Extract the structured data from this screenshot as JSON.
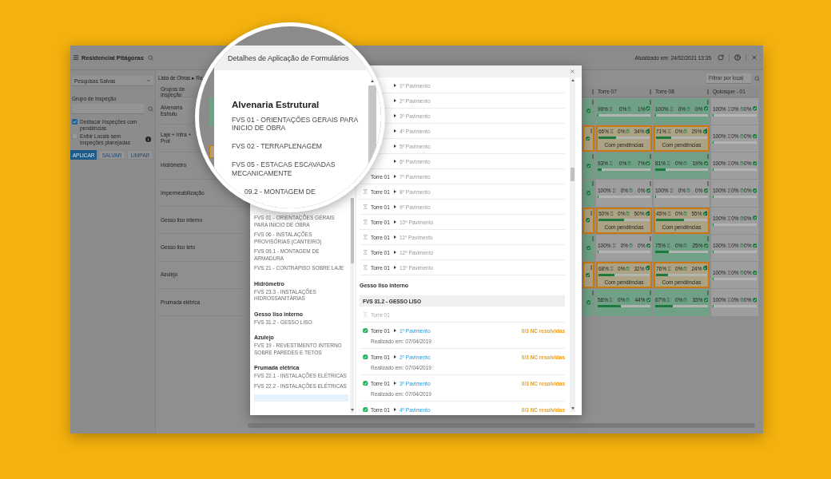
{
  "app": {
    "title": "Residencial Pitágoras",
    "updated": "Atualizado em: 24/02/2021 13:35",
    "sidebar": {
      "saved_searches": "Pesquisas Salvas",
      "group_label": "Grupo de Inspeção",
      "options": [
        {
          "label": "Destacar Inspeções com pendências",
          "checked": true,
          "info": false
        },
        {
          "label": "Exibir Locais sem Inspeções planejadas",
          "checked": false,
          "info": true
        }
      ],
      "buttons": [
        {
          "label": "APLICAR",
          "primary": true
        },
        {
          "label": "SALVAR",
          "primary": false
        },
        {
          "label": "LIMPAR",
          "primary": false
        }
      ]
    },
    "breadcrumb": "Lista de Obras ▸ Re",
    "filter": {
      "placeholder": "Filtrar por local"
    },
    "grid": {
      "row_header": "Grupos de Inspeção",
      "columns": [
        {
          "menu": true
        },
        {
          "label": "Torre 07",
          "menu": true
        },
        {
          "label": "Torre 08",
          "menu": true
        },
        {
          "label": "Quiosque - 01",
          "menu": false
        }
      ],
      "rows": [
        {
          "label": "Alvenaria Estrutu",
          "cells": [
            {
              "color": "#70a086",
              "highlighted": false,
              "menu": true
            },
            {
              "color": "#70a086",
              "highlighted": false,
              "waiting": "99%",
              "open": "0%",
              "done": "1%",
              "level": 0.01,
              "menu": true
            },
            {
              "color": "#70a086",
              "highlighted": false,
              "waiting": "100%",
              "open": "0%",
              "done": "0%",
              "level": 0,
              "menu": true
            },
            {
              "color": "#9e9e9e",
              "highlighted": false,
              "waiting": "100%",
              "open": "0%",
              "done": "0%",
              "level": 0,
              "menu": false
            }
          ]
        },
        {
          "label": "Laje + Infra + Prot",
          "cells": [
            {
              "color": "#aca385",
              "highlighted": true,
              "menu": true
            },
            {
              "color": "#aca385",
              "highlighted": true,
              "waiting": "66%",
              "open": "0%",
              "done": "34%",
              "level": 0.34,
              "note": "Com pendências",
              "menu": true
            },
            {
              "color": "#aca385",
              "highlighted": true,
              "waiting": "71%",
              "open": "0%",
              "done": "29%",
              "level": 0.29,
              "note": "Com pendências",
              "menu": true
            },
            {
              "color": "#9e9e9e",
              "highlighted": false,
              "waiting": "100%",
              "open": "0%",
              "done": "0%",
              "level": 0,
              "menu": false
            }
          ]
        },
        {
          "label": "Hidrômetro",
          "cells": [
            {
              "color": "#70a086",
              "highlighted": false,
              "menu": true
            },
            {
              "color": "#70a086",
              "highlighted": false,
              "waiting": "93%",
              "open": "0%",
              "done": "7%",
              "level": 0.07,
              "menu": true
            },
            {
              "color": "#70a086",
              "highlighted": false,
              "waiting": "81%",
              "open": "0%",
              "done": "19%",
              "level": 0.19,
              "menu": true
            },
            {
              "color": "#9e9e9e",
              "highlighted": false,
              "waiting": "100%",
              "open": "0%",
              "done": "0%",
              "level": 0,
              "menu": false
            }
          ]
        },
        {
          "label": "Impermeabilização",
          "cells": [
            {
              "color": "#70a086",
              "highlighted": false,
              "menu": true
            },
            {
              "color": "#9e9e9e",
              "highlighted": false,
              "waiting": "100%",
              "open": "0%",
              "done": "0%",
              "level": 0,
              "menu": true
            },
            {
              "color": "#9e9e9e",
              "highlighted": false,
              "waiting": "100%",
              "open": "0%",
              "done": "0%",
              "level": 0,
              "menu": true
            },
            {
              "color": "#9e9e9e",
              "highlighted": false,
              "waiting": "100%",
              "open": "0%",
              "done": "0%",
              "level": 0,
              "menu": false
            }
          ]
        },
        {
          "label": "Gesso liso interno",
          "cells": [
            {
              "color": "#aca385",
              "highlighted": true,
              "menu": true
            },
            {
              "color": "#aca385",
              "highlighted": true,
              "waiting": "50%",
              "open": "0%",
              "done": "50%",
              "level": 0.5,
              "note": "Com pendências",
              "menu": true
            },
            {
              "color": "#aca385",
              "highlighted": true,
              "waiting": "45%",
              "open": "0%",
              "done": "55%",
              "level": 0.55,
              "note": "Com pendências",
              "menu": true
            },
            {
              "color": "#9e9e9e",
              "highlighted": false,
              "waiting": "100%",
              "open": "0%",
              "done": "0%",
              "level": 0,
              "menu": false
            }
          ]
        },
        {
          "label": "Gesso liso teto",
          "cells": [
            {
              "color": "#70a086",
              "highlighted": false,
              "menu": true
            },
            {
              "color": "#9e9e9e",
              "highlighted": false,
              "waiting": "100%",
              "open": "0%",
              "done": "0%",
              "level": 0,
              "menu": true
            },
            {
              "color": "#70a086",
              "highlighted": false,
              "waiting": "75%",
              "open": "0%",
              "done": "25%",
              "level": 0.25,
              "menu": true
            },
            {
              "color": "#9e9e9e",
              "highlighted": false,
              "waiting": "100%",
              "open": "0%",
              "done": "0%",
              "level": 0,
              "menu": false
            }
          ]
        },
        {
          "label": "Azulejo",
          "cells": [
            {
              "color": "#aca385",
              "highlighted": true,
              "menu": true
            },
            {
              "color": "#aca385",
              "highlighted": true,
              "waiting": "68%",
              "open": "0%",
              "done": "32%",
              "level": 0.32,
              "note": "Com pendências",
              "menu": true
            },
            {
              "color": "#aca385",
              "highlighted": true,
              "waiting": "76%",
              "open": "0%",
              "done": "24%",
              "level": 0.24,
              "note": "Com pendências",
              "menu": true
            },
            {
              "color": "#9e9e9e",
              "highlighted": false,
              "waiting": "100%",
              "open": "0%",
              "done": "0%",
              "level": 0,
              "menu": false
            }
          ]
        },
        {
          "label": "Prumada elétrica",
          "cells": [
            {
              "color": "#70a086",
              "highlighted": false,
              "menu": true
            },
            {
              "color": "#70a086",
              "highlighted": false,
              "waiting": "56%",
              "open": "0%",
              "done": "44%",
              "level": 0.44,
              "menu": true
            },
            {
              "color": "#70a086",
              "highlighted": false,
              "waiting": "67%",
              "open": "0%",
              "done": "33%",
              "level": 0.33,
              "menu": true
            },
            {
              "color": "#9e9e9e",
              "highlighted": false,
              "waiting": "100%",
              "open": "0%",
              "done": "0%",
              "level": 0,
              "menu": false
            }
          ]
        }
      ]
    }
  },
  "modal": {
    "form_groups": [
      {
        "forms": [
          "FVS 01 - ORIENTAÇÕES GERAIS PARA INICIO DE OBRA",
          "FVS 06 - INSTALAÇÕES PROVISÓRIAS (CANTEIRO)",
          "FVS 09.1 - MONTAGEM DE ARMADURA",
          "FVS 21 - CONTRAPISO SOBRE LAJE"
        ]
      },
      {
        "name": "Hidrômetro",
        "forms": [
          "FVS 23.3 - INSTALAÇÕES HIDROSSANITÁRIAS"
        ]
      },
      {
        "name": "Gesso liso interno",
        "forms": [
          "FVS 31.2 - GESSO LISO"
        ]
      },
      {
        "name": "Azulejo",
        "forms": [
          "FVS 19 - REVESTIMENTO INTERNO SOBRE PAREDES E TETOS"
        ]
      },
      {
        "name": "Prumada elétrica",
        "forms": [
          "FVS 22.1 - INSTALAÇÕES ELÉTRICAS",
          "FVS 22.2 - INSTALAÇÕES ELÉTRICAS"
        ]
      }
    ],
    "locations": [
      {
        "floor": "1º Pavimento"
      },
      {
        "floor": "2º Pavimento"
      },
      {
        "floor": "3º Pavimento"
      },
      {
        "floor": "4º Pavimento"
      },
      {
        "floor": "5º Pavimento"
      },
      {
        "floor": "6º Pavimento"
      },
      {
        "building": "Torre 01",
        "floor": "7º Pavimento"
      },
      {
        "kind": "pending",
        "building": "Torre 01",
        "floor": "8º Pavimento"
      },
      {
        "kind": "pending",
        "building": "Torre 01",
        "floor": "9º Pavimento"
      },
      {
        "kind": "pending",
        "building": "Torre 01",
        "floor": "10º Pavimento"
      },
      {
        "kind": "pending",
        "building": "Torre 01",
        "floor": "11º Pavimento"
      },
      {
        "kind": "pending",
        "building": "Torre 01",
        "floor": "12º Pavimento"
      },
      {
        "kind": "pending",
        "building": "Torre 01",
        "floor": "13º Pavimento"
      }
    ],
    "sections": [
      {
        "name": "Gesso liso interno",
        "form": "FVS 31.2 - GESSO LISO",
        "entries": [
          {
            "kind": "pending",
            "building": "Torre 01"
          },
          {
            "kind": "done",
            "building": "Torre 01",
            "floor": "1º Pavimento",
            "issues": "0/3 NC resolvidas",
            "date": "Realizado em: 07/04/2019"
          },
          {
            "kind": "done",
            "building": "Torre 01",
            "floor": "2º Pavimento",
            "issues": "0/3 NC resolvidas",
            "date": "Realizado em: 07/04/2019"
          },
          {
            "kind": "done",
            "building": "Torre 01",
            "floor": "3º Pavimento",
            "issues": "0/3 NC resolvidas",
            "date": "Realizado em: 07/04/2019"
          },
          {
            "kind": "done",
            "building": "Torre 01",
            "floor": "4º Pavimento",
            "issues": "0/3 NC resolvidas"
          }
        ]
      }
    ]
  },
  "magnifier": {
    "title": "Detalhes de Aplicação de Formulários",
    "group": "Alvenaria Estrutural",
    "forms": [
      "FVS 01 - ORIENTAÇÕES GERAIS PARA INICIO DE OBRA",
      "FVS 02 - TERRAPLENAGEM",
      "FVS 05 - ESTACAS ESCAVADAS MECANICAMENTE",
      "09.2 - MONTAGEM DE"
    ]
  }
}
